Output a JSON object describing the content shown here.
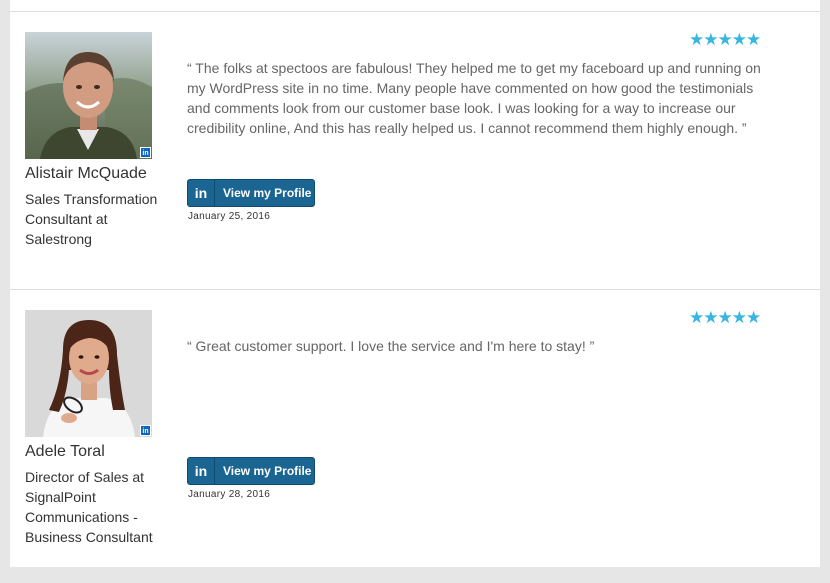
{
  "testimonials": [
    {
      "name": "Alistair McQuade",
      "title": "Sales Transformation Consultant at Salestrong",
      "stars": "★★★★★",
      "rating": 5,
      "quote": "“ The folks at spectoos are fabulous! They helped me to get my faceboard up and running on my WordPress site in no time. Many people have commented on how good the testimonials and comments look from our customer base look. I was looking for a way to increase our credibility online, And this has really helped us. I cannot recommend them highly enough. ”",
      "button_label": "View my Profile",
      "date": "January 25, 2016",
      "badge": "in"
    },
    {
      "name": "Adele Toral",
      "title": "Director of Sales at SignalPoint Communications - Business Consultant",
      "stars": "★★★★★",
      "rating": 5,
      "quote": "“ Great customer support. I love the service and I'm here to stay! ”",
      "button_label": "View my Profile",
      "date": "January 28, 2016",
      "badge": "in"
    }
  ],
  "icons": {
    "linkedin": "linkedin-icon",
    "star": "star-icon"
  },
  "colors": {
    "accent": "#38b6e0",
    "button": "#1b6593",
    "badge": "#0a66c2"
  }
}
